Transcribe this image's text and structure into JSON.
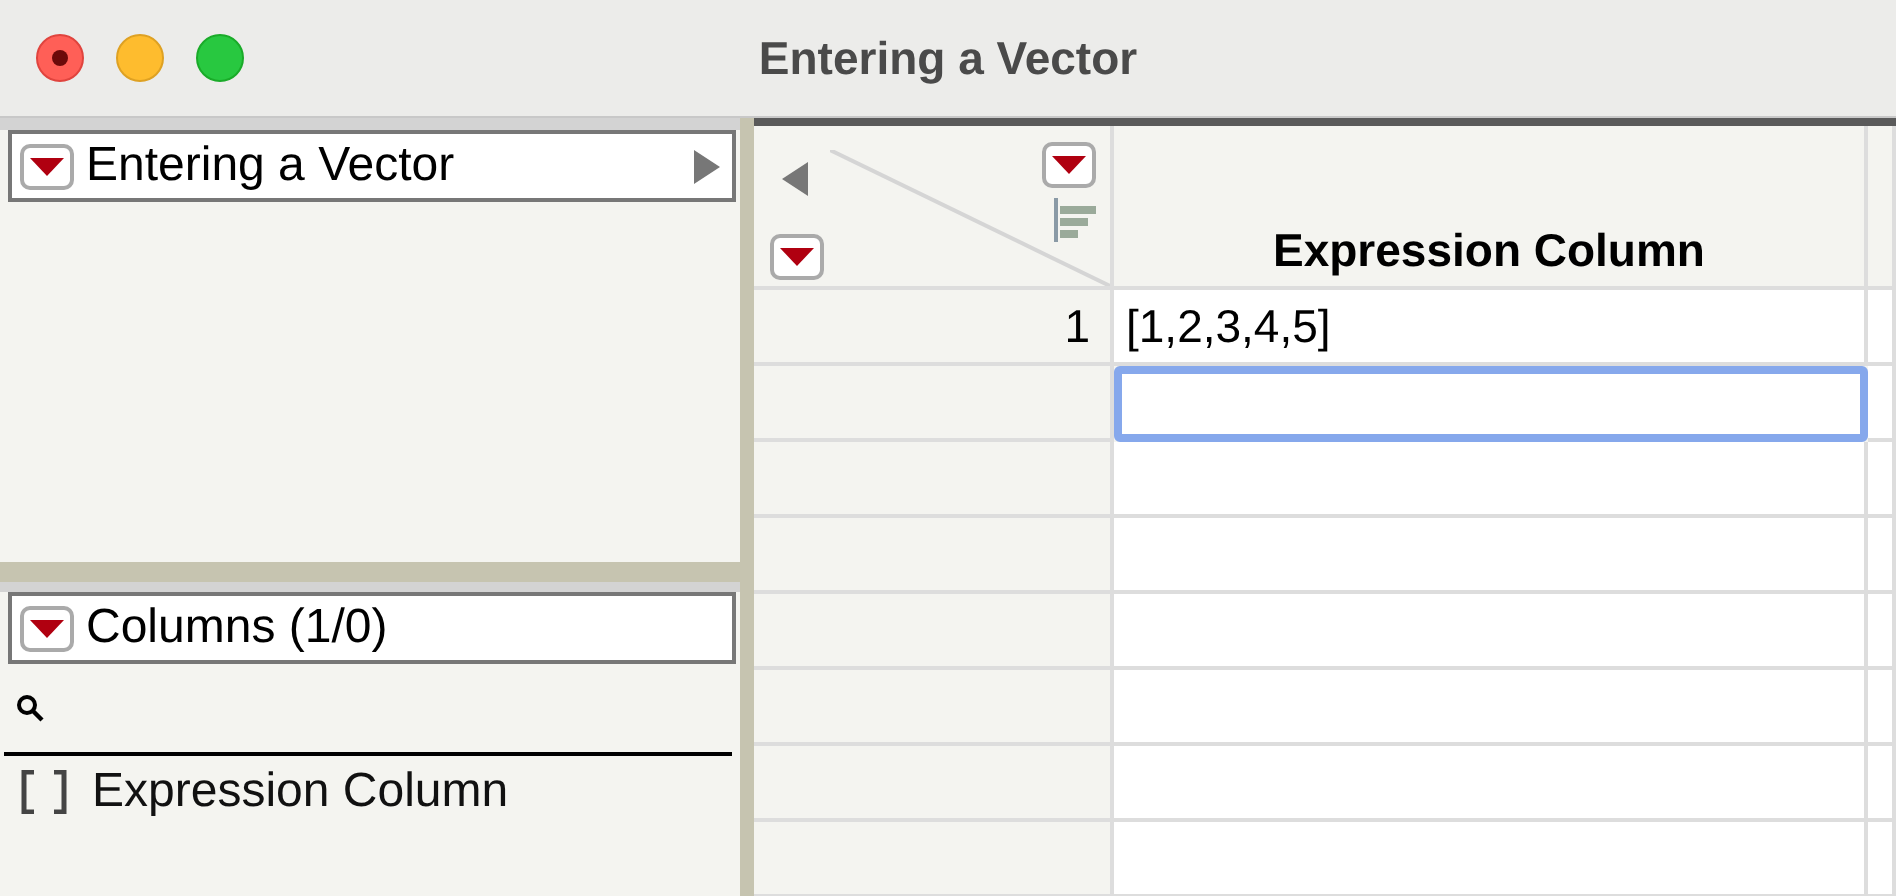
{
  "window": {
    "title": "Entering a Vector"
  },
  "table_panel": {
    "title": "Entering a Vector"
  },
  "columns_panel": {
    "title": "Columns (1/0)",
    "items": [
      {
        "name": "Expression Column"
      }
    ]
  },
  "table": {
    "columns": [
      "Expression Column"
    ],
    "rows": [
      {
        "number": "1",
        "value": "[1,2,3,4,5]",
        "selected": false
      },
      {
        "selected": true
      }
    ]
  }
}
